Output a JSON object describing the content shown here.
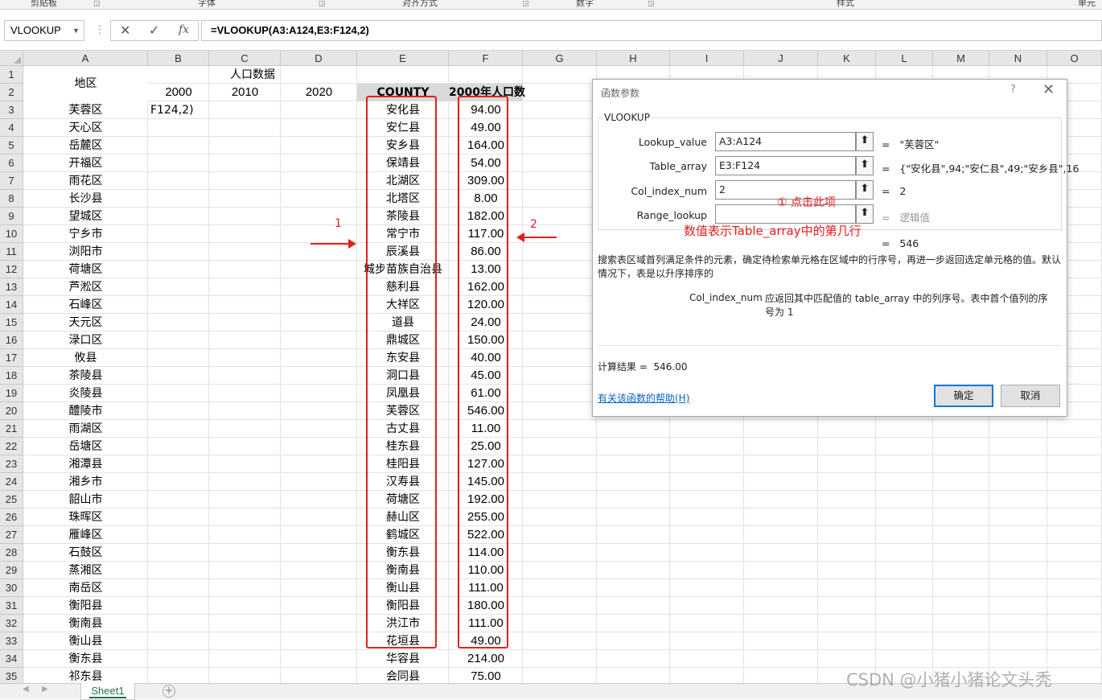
{
  "ribbon": {
    "groups": [
      {
        "label": "剪贴板"
      },
      {
        "label": "字体"
      },
      {
        "label": "对齐方式"
      },
      {
        "label": "数字"
      },
      {
        "label": "样式"
      },
      {
        "label": "单元"
      }
    ]
  },
  "formula_bar": {
    "name_box": "VLOOKUP",
    "cancel_glyph": "✕",
    "enter_glyph": "✓",
    "fx_glyph": "fx",
    "formula": "=VLOOKUP(A3:A124,E3:F124,2)"
  },
  "columns": [
    "A",
    "B",
    "C",
    "D",
    "E",
    "F",
    "G",
    "H",
    "I",
    "J",
    "K",
    "L",
    "M",
    "N",
    "O"
  ],
  "rows": [
    "1",
    "2",
    "3",
    "4",
    "5",
    "6",
    "7",
    "8",
    "9",
    "10",
    "11",
    "12",
    "13",
    "14",
    "15",
    "16",
    "17",
    "18",
    "19",
    "20",
    "21",
    "22",
    "23",
    "24",
    "25",
    "26",
    "27",
    "28",
    "29",
    "30",
    "31",
    "32",
    "33",
    "34",
    "35"
  ],
  "header_cells": {
    "a_header": "地区",
    "population_header": "人口数据",
    "year_2000": "2000",
    "year_2010": "2010",
    "year_2020": "2020",
    "county_header": "COUNTY",
    "pop2000_header": "2000年人口数"
  },
  "b3_edit_text": "F124,2)",
  "districts": [
    "芙蓉区",
    "天心区",
    "岳麓区",
    "开福区",
    "雨花区",
    "长沙县",
    "望城区",
    "宁乡市",
    "浏阳市",
    "荷塘区",
    "芦淞区",
    "石峰区",
    "天元区",
    "渌口区",
    "攸县",
    "茶陵县",
    "炎陵县",
    "醴陵市",
    "雨湖区",
    "岳塘区",
    "湘潭县",
    "湘乡市",
    "韶山市",
    "珠晖区",
    "雁峰区",
    "石鼓区",
    "蒸湘区",
    "南岳区",
    "衡阳县",
    "衡南县",
    "衡山县",
    "衡东县",
    "祁东县"
  ],
  "counties": [
    "安化县",
    "安仁县",
    "安乡县",
    "保靖县",
    "北湖区",
    "北塔区",
    "茶陵县",
    "常宁市",
    "辰溪县",
    "城步苗族自治县",
    "慈利县",
    "大祥区",
    "道县",
    "鼎城区",
    "东安县",
    "洞口县",
    "凤凰县",
    "芙蓉区",
    "古丈县",
    "桂东县",
    "桂阳县",
    "汉寿县",
    "荷塘区",
    "赫山区",
    "鹤城区",
    "衡东县",
    "衡南县",
    "衡山县",
    "衡阳县",
    "洪江市",
    "花垣县",
    "华容县",
    "会同县"
  ],
  "pop2000": [
    "94.00",
    "49.00",
    "164.00",
    "54.00",
    "309.00",
    "8.00",
    "182.00",
    "117.00",
    "86.00",
    "13.00",
    "162.00",
    "120.00",
    "24.00",
    "150.00",
    "40.00",
    "45.00",
    "61.00",
    "546.00",
    "11.00",
    "25.00",
    "127.00",
    "145.00",
    "192.00",
    "255.00",
    "522.00",
    "114.00",
    "110.00",
    "111.00",
    "180.00",
    "111.00",
    "49.00",
    "214.00",
    "75.00"
  ],
  "annotations": {
    "label_1": "1",
    "label_2": "2",
    "click_hint": "① 点击此项",
    "row_hint": "数值表示Table_array中的第几行",
    "color": "#e02020"
  },
  "dialog": {
    "title": "函数参数",
    "help_glyph": "?",
    "close_glyph": "✕",
    "function_name": "VLOOKUP",
    "args": [
      {
        "label": "Lookup_value",
        "value": "A3:A124",
        "result": "\"芙蓉区\""
      },
      {
        "label": "Table_array",
        "value": "E3:F124",
        "result": "{\"安化县\",94;\"安仁县\",49;\"安乡县\",16"
      },
      {
        "label": "Col_index_num",
        "value": "2",
        "result": "2"
      },
      {
        "label": "Range_lookup",
        "value": "",
        "result": "逻辑值"
      }
    ],
    "equals": "=",
    "ref_glyph": "⬆",
    "formula_result": "546",
    "description": "搜索表区域首列满足条件的元素，确定待检索单元格在区域中的行序号，再进一步返回选定单元格的值。默认情况下，表是以升序排序的",
    "arg_desc_name": "Col_index_num",
    "arg_desc_text": "应返回其中匹配值的 table_array 中的列序号。表中首个值列的序号为 1",
    "calc_label": "计算结果 =",
    "calc_value": "546.00",
    "help_link": "有关该函数的帮助(H)",
    "ok": "确定",
    "cancel": "取消"
  },
  "tabs": {
    "sheet1": "Sheet1",
    "add_glyph": "+"
  },
  "watermark": "CSDN @小猪小猪论文头秃"
}
